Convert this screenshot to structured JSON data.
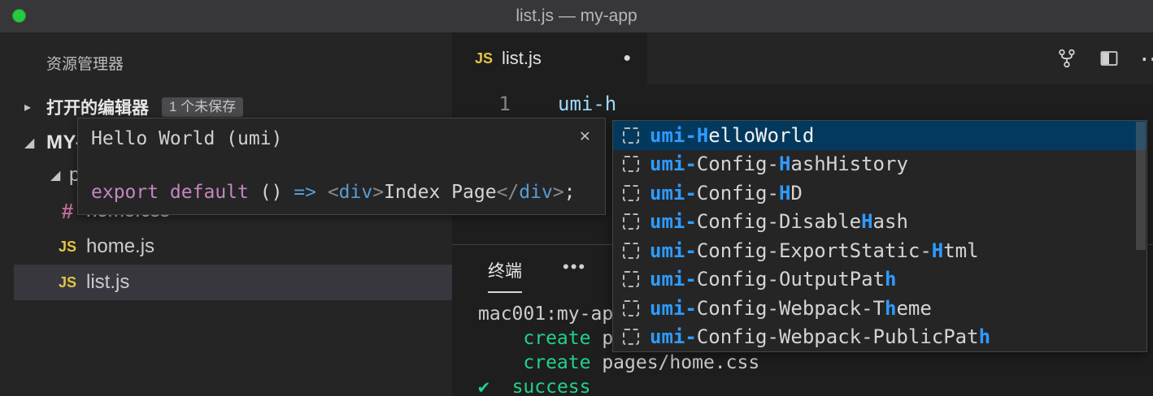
{
  "window": {
    "title": "list.js — my-app"
  },
  "icons": {
    "collapsed_chevron": "▸",
    "expanded_chevron": "◢",
    "js": "JS",
    "css": "#",
    "more_editor": "⋯"
  },
  "colors": {
    "accent_blue": "#2e9bff",
    "suggest_selection_bg": "#04395e",
    "terminal_green": "#23d18b",
    "js_yellow": "#e2c542",
    "css_pink": "#c76b9c",
    "keyword_pink": "#c586c0",
    "tag_blue": "#569cd6",
    "traffic_green": "#28c840"
  },
  "sidebar": {
    "title": "资源管理器",
    "open_editors": {
      "label": "打开的编辑器",
      "badge": "1 个未保存"
    },
    "root_folder": "MY-APP",
    "tree": [
      {
        "name": "pages",
        "type": "folder"
      },
      {
        "name": "home.css",
        "type": "css"
      },
      {
        "name": "home.js",
        "type": "js"
      },
      {
        "name": "list.js",
        "type": "js",
        "selected": true
      }
    ]
  },
  "hover": {
    "title": "Hello World (umi)",
    "close_label": "✕",
    "code": [
      {
        "t": "export default",
        "c": "keyword"
      },
      {
        "t": " () ",
        "c": "fg"
      },
      {
        "t": "=> ",
        "c": "blue"
      },
      {
        "t": "<",
        "c": "punct"
      },
      {
        "t": "div",
        "c": "blue"
      },
      {
        "t": ">",
        "c": "punct"
      },
      {
        "t": "Index Page",
        "c": "fg"
      },
      {
        "t": "</",
        "c": "punct"
      },
      {
        "t": "div",
        "c": "blue"
      },
      {
        "t": ">",
        "c": "punct"
      },
      {
        "t": ";",
        "c": "fg"
      }
    ]
  },
  "editor": {
    "tab": {
      "icon": "JS",
      "label": "list.js",
      "dirty": "●"
    },
    "line_number": "1",
    "code": "umi-h"
  },
  "suggest": {
    "items": [
      {
        "selected": true,
        "segments": [
          {
            "t": "umi-H",
            "hl": true
          },
          {
            "t": "elloWorld"
          }
        ]
      },
      {
        "segments": [
          {
            "t": "umi-",
            "hl": true
          },
          {
            "t": "Config-"
          },
          {
            "t": "H",
            "hl": true
          },
          {
            "t": "ashHistory"
          }
        ]
      },
      {
        "segments": [
          {
            "t": "umi-",
            "hl": true
          },
          {
            "t": "Config-"
          },
          {
            "t": "H",
            "hl": true
          },
          {
            "t": "D"
          }
        ]
      },
      {
        "segments": [
          {
            "t": "umi-",
            "hl": true
          },
          {
            "t": "Config-Disable"
          },
          {
            "t": "H",
            "hl": true
          },
          {
            "t": "ash"
          }
        ]
      },
      {
        "segments": [
          {
            "t": "umi-",
            "hl": true
          },
          {
            "t": "Config-ExportStatic-"
          },
          {
            "t": "H",
            "hl": true
          },
          {
            "t": "tml"
          }
        ]
      },
      {
        "segments": [
          {
            "t": "umi-",
            "hl": true
          },
          {
            "t": "Config-OutputPat"
          },
          {
            "t": "h",
            "hl": true
          }
        ]
      },
      {
        "segments": [
          {
            "t": "umi-",
            "hl": true
          },
          {
            "t": "Config-Webpack-T"
          },
          {
            "t": "h",
            "hl": true
          },
          {
            "t": "eme"
          }
        ]
      },
      {
        "segments": [
          {
            "t": "umi-",
            "hl": true
          },
          {
            "t": "Config-Webpack-PublicPat"
          },
          {
            "t": "h",
            "hl": true
          }
        ]
      }
    ]
  },
  "panel": {
    "tab": "终端",
    "more": "•••",
    "lines": [
      [
        {
          "t": "mac001:my-ap"
        }
      ],
      [
        {
          "t": "    "
        },
        {
          "t": "create",
          "c": "green"
        },
        {
          "t": " p"
        }
      ],
      [
        {
          "t": "    "
        },
        {
          "t": "create",
          "c": "green"
        },
        {
          "t": " pages/home.css"
        }
      ],
      [
        {
          "t": "✔ ",
          "c": "green"
        },
        {
          "t": " "
        },
        {
          "t": "success",
          "c": "green",
          "u": true
        }
      ]
    ]
  }
}
